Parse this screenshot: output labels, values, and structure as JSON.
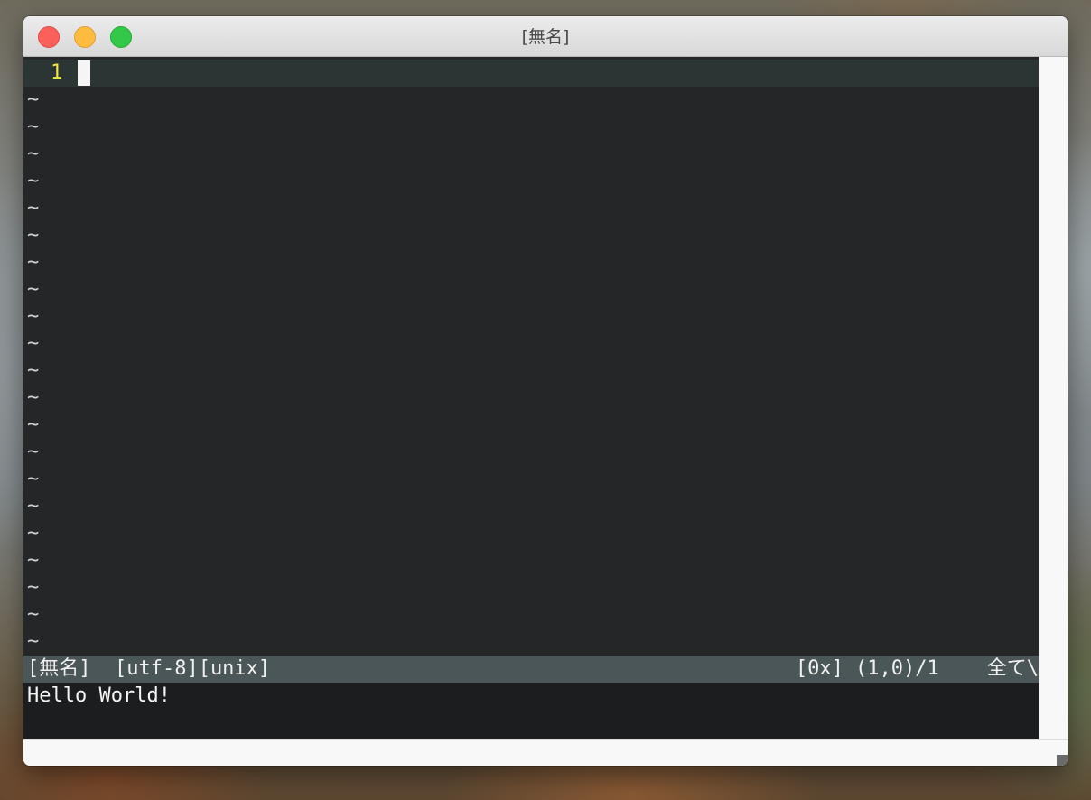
{
  "window": {
    "title": "[無名]"
  },
  "editor": {
    "line_numbers": [
      "1"
    ],
    "empty_line_marker": "~",
    "empty_line_count": 21
  },
  "statusline": {
    "left": "[無名]  [utf-8][unix]",
    "right": "[0x] (1,0)/1    全て\\"
  },
  "cmdline": {
    "message": "Hello World!"
  },
  "colors": {
    "background": "#242628",
    "cursorline": "#2b3534",
    "line_number": "#f2e742",
    "statusline": "#4a5657",
    "cmdline": "#1c1d1e",
    "text": "#f0f0f0"
  },
  "icons": {
    "close": "close-button-icon",
    "minimize": "minimize-button-icon",
    "maximize": "zoom-button-icon"
  }
}
